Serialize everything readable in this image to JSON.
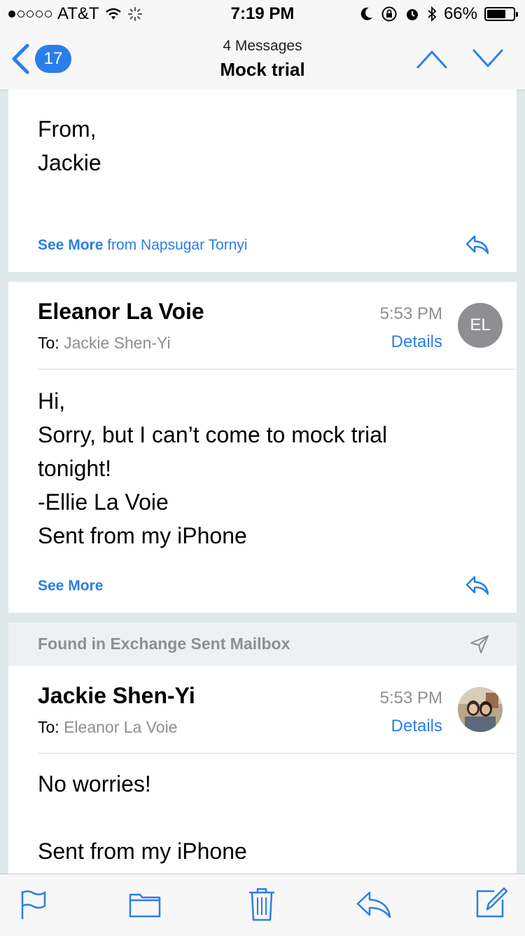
{
  "status_bar": {
    "carrier": "AT&T",
    "time": "7:19 PM",
    "battery": "66%"
  },
  "nav": {
    "back_count": "17",
    "subtitle": "4 Messages",
    "title": "Mock trial"
  },
  "messages": [
    {
      "body_lines": [
        "From,",
        "Jackie"
      ],
      "see_more": "See More",
      "see_more_from": "from Napsugar Tornyi"
    },
    {
      "sender": "Eleanor La Voie",
      "to_label": "To:",
      "to_name": "Jackie Shen-Yi",
      "time": "5:53 PM",
      "details": "Details",
      "avatar_initials": "EL",
      "body_lines": [
        "Hi,",
        "Sorry, but I can’t come to mock trial",
        "tonight!",
        "-Ellie La Voie",
        "Sent from my iPhone"
      ],
      "see_more": "See More"
    },
    {
      "found_in": "Found in Exchange Sent Mailbox",
      "sender": "Jackie Shen-Yi",
      "to_label": "To:",
      "to_name": "Eleanor La Voie",
      "time": "5:53 PM",
      "details": "Details",
      "body_lines": [
        "No worries!",
        "",
        "Sent from my iPhone"
      ]
    }
  ],
  "colors": {
    "accent": "#2a7ee8",
    "background": "#dfe9ea",
    "secondary_text": "#8e8e93"
  },
  "icons": {
    "toolbar": [
      "flag-icon",
      "folder-icon",
      "trash-icon",
      "reply-icon",
      "compose-icon"
    ]
  }
}
